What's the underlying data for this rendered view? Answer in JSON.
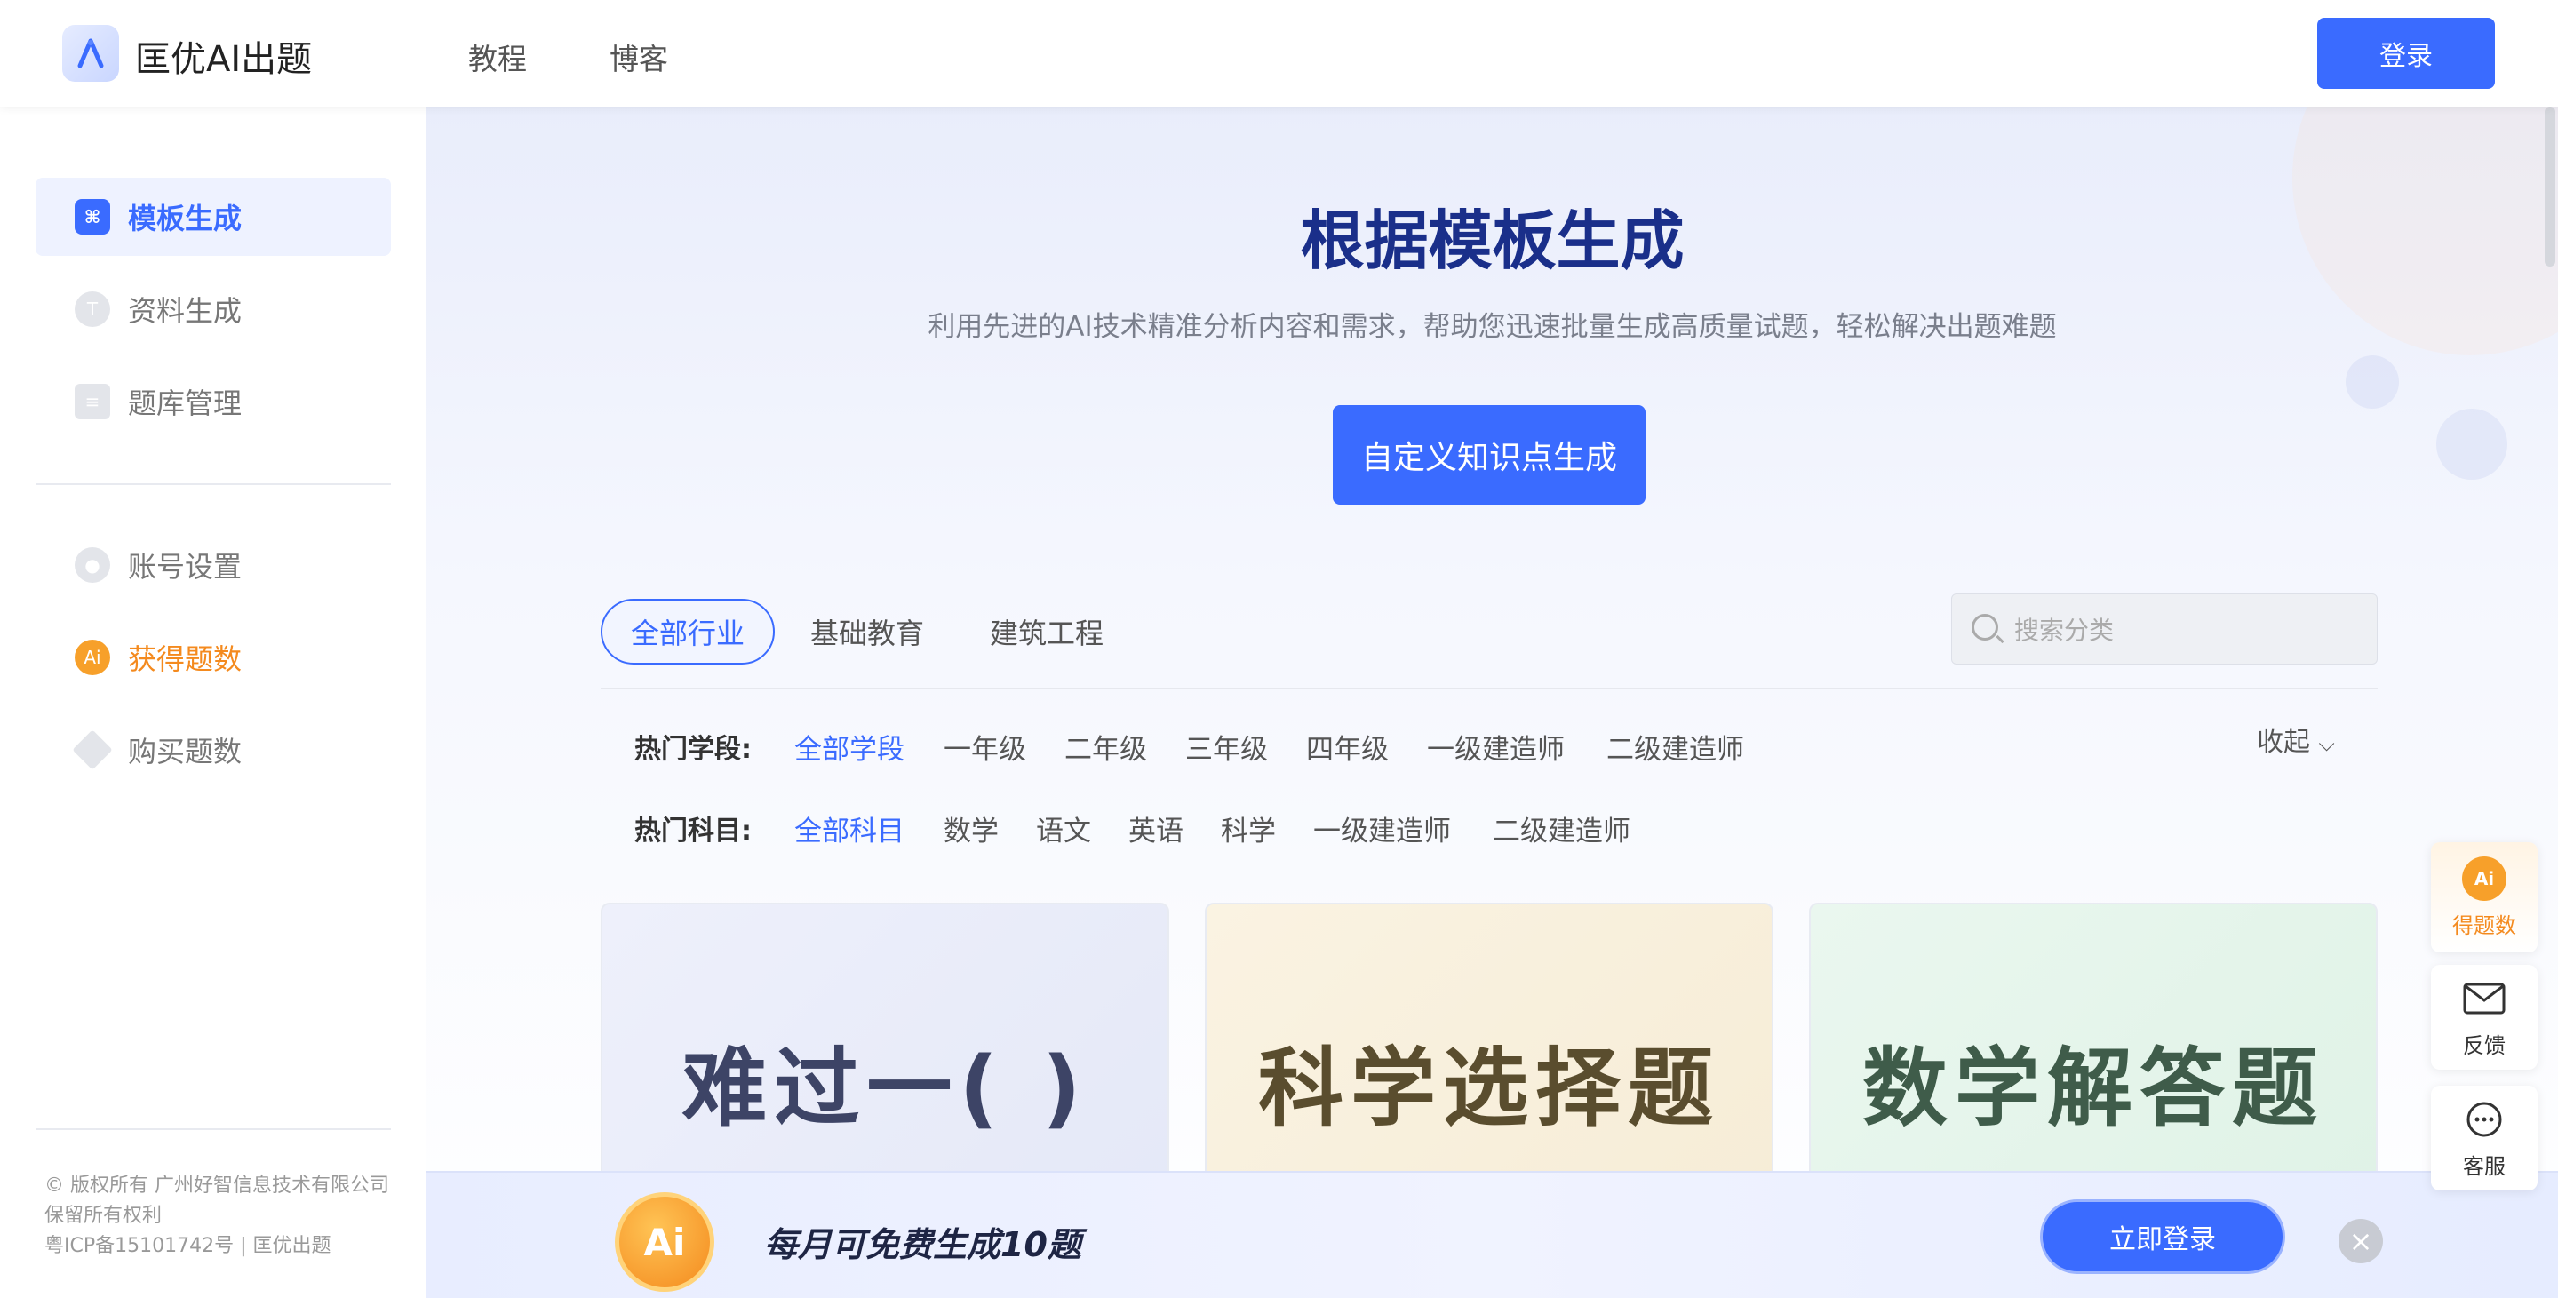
{
  "header": {
    "brand": "匡优AI出题",
    "nav": [
      "教程",
      "博客"
    ],
    "login_label": "登录"
  },
  "sidebar": {
    "items": [
      {
        "label": "模板生成",
        "icon": "template-icon"
      },
      {
        "label": "资料生成",
        "icon": "text-icon"
      },
      {
        "label": "题库管理",
        "icon": "list-icon"
      },
      {
        "label": "账号设置",
        "icon": "user-icon"
      },
      {
        "label": "获得题数",
        "icon": "ai-coin-icon"
      },
      {
        "label": "购买题数",
        "icon": "diamond-icon"
      }
    ],
    "footer": [
      "© 版权所有 广州好智信息技术有限公司",
      "保留所有权利",
      "粤ICP备15101742号 | 匡优出题"
    ]
  },
  "hero": {
    "title": "根据模板生成",
    "subtitle": "利用先进的AI技术精准分析内容和需求，帮助您迅速批量生成高质量试题，轻松解决出题难题",
    "button_label": "自定义知识点生成"
  },
  "tabs": [
    "全部行业",
    "基础教育",
    "建筑工程"
  ],
  "search": {
    "placeholder": "搜索分类"
  },
  "filters": {
    "stage_label": "热门学段:",
    "stages": [
      "全部学段",
      "一年级",
      "二年级",
      "三年级",
      "四年级",
      "一级建造师",
      "二级建造师"
    ],
    "subject_label": "热门科目:",
    "subjects": [
      "全部科目",
      "数学",
      "语文",
      "英语",
      "科学",
      "一级建造师",
      "二级建造师"
    ],
    "collapse_label": "收起"
  },
  "cards": [
    {
      "title": "难过一(    )",
      "color": "#3d4466"
    },
    {
      "title": "科学选择题",
      "color": "#5a4d2e"
    },
    {
      "title": "数学解答题",
      "color": "#3f5c4a"
    }
  ],
  "banner": {
    "coin_text": "Ai",
    "text": "每月可免费生成10题",
    "button_label": "立即登录"
  },
  "floating": [
    {
      "label": "得题数",
      "icon": "ai-coin-icon"
    },
    {
      "label": "反馈",
      "icon": "mail-icon"
    },
    {
      "label": "客服",
      "icon": "chat-icon"
    }
  ],
  "colors": {
    "accent": "#3a6bff",
    "orange": "#f48a1e",
    "title": "#1a2f8a"
  }
}
